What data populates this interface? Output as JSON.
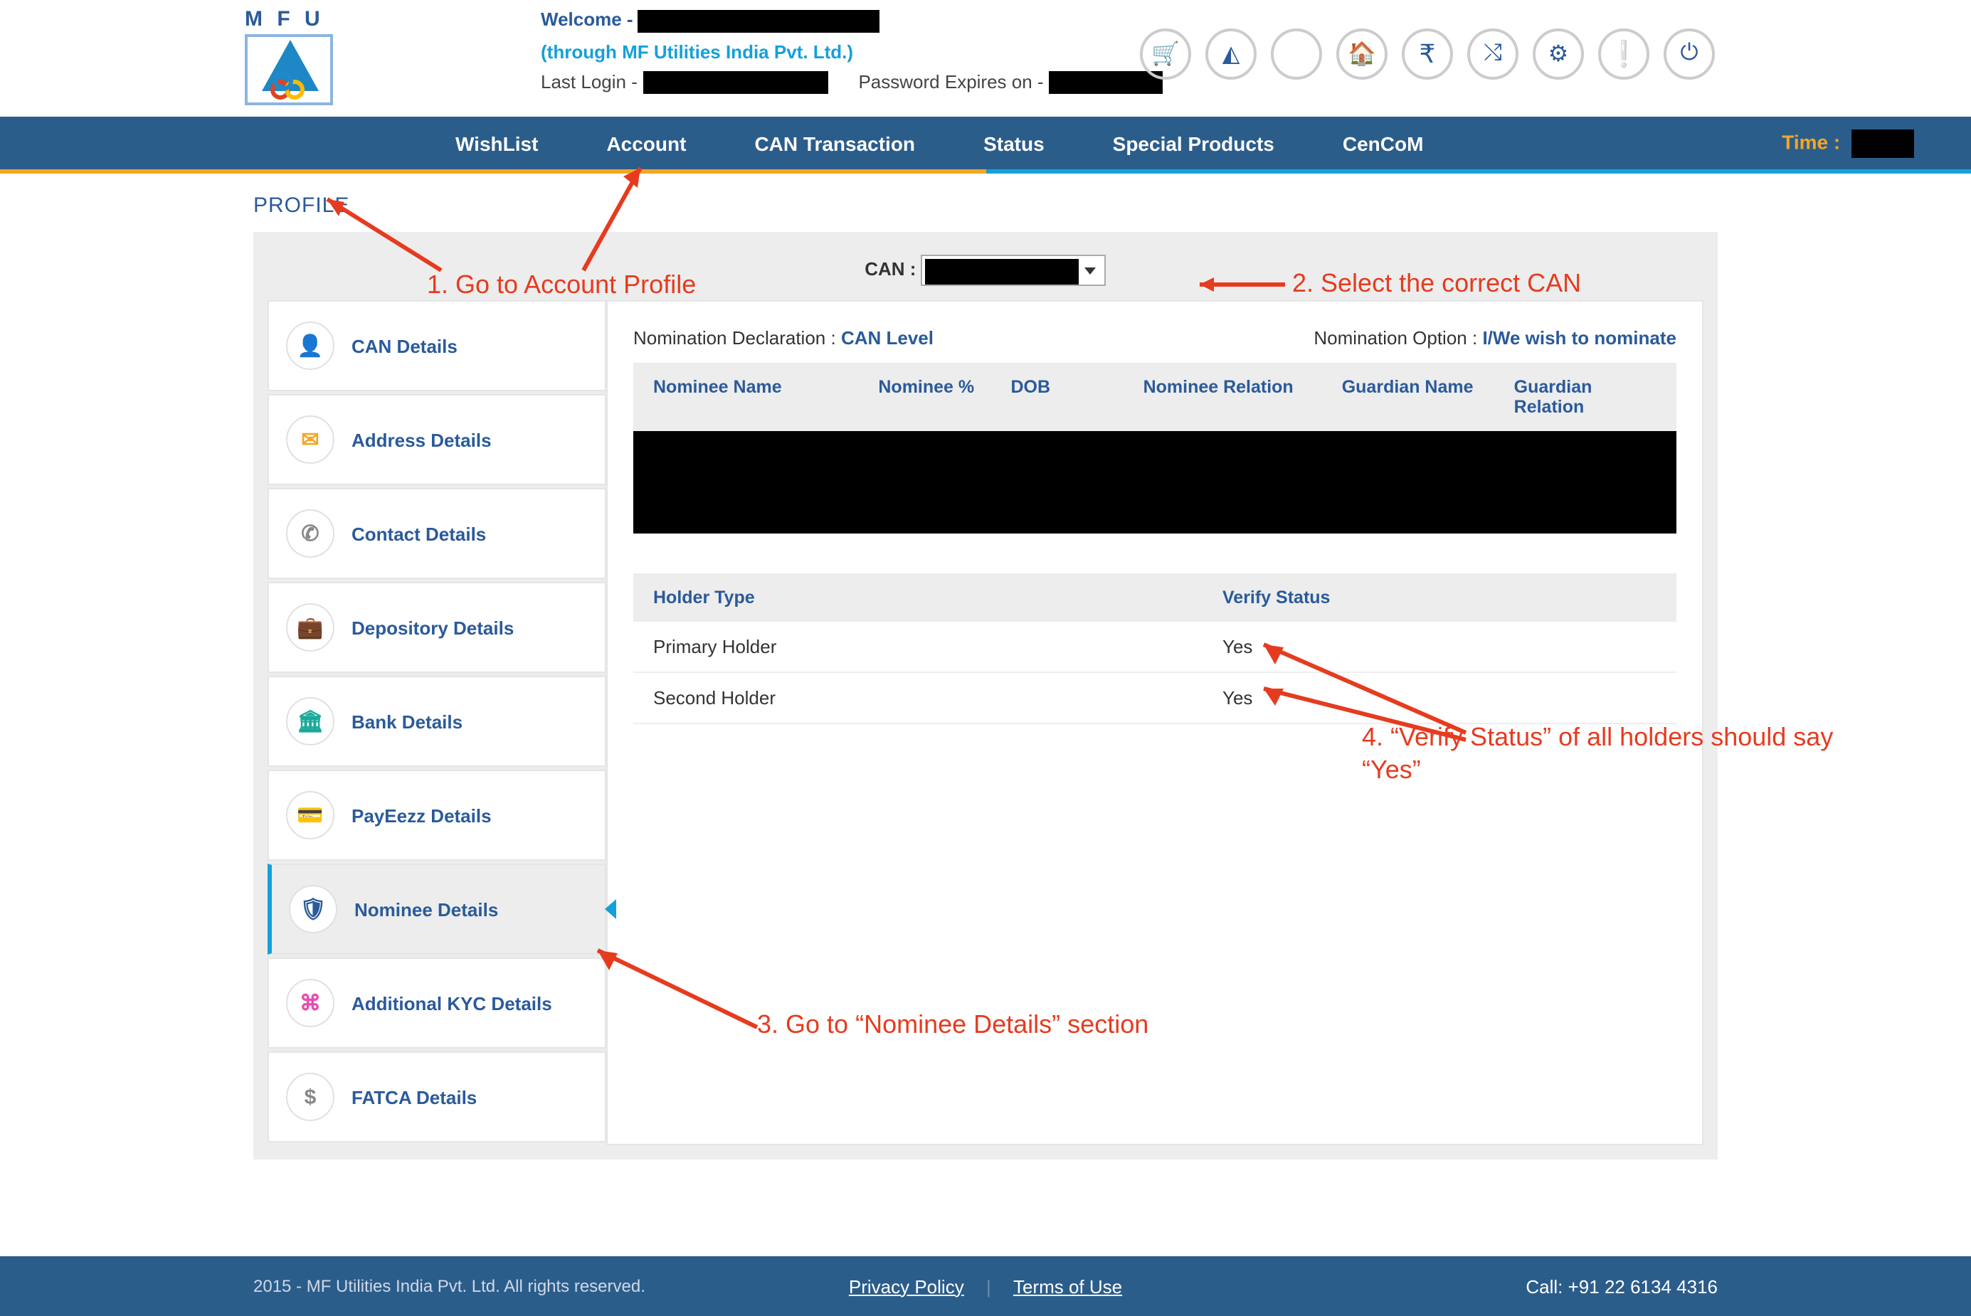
{
  "brand": {
    "name": "M F U"
  },
  "welcome": {
    "label": "Welcome - ",
    "through": "(through MF Utilities India Pvt. Ltd.)",
    "last_login_label": "Last Login -",
    "pw_expires_label": "Password Expires on -"
  },
  "top_icons": [
    "cart",
    "nav-triangle",
    "blank",
    "home",
    "rupee",
    "shuffle",
    "gear",
    "alert",
    "power"
  ],
  "nav": {
    "items": [
      "WishList",
      "Account",
      "CAN Transaction",
      "Status",
      "Special Products",
      "CenCoM"
    ],
    "time_label": "Time :"
  },
  "page_title": "PROFILE",
  "can_selector": {
    "label": "CAN :"
  },
  "sidebar": {
    "items": [
      {
        "icon": "user",
        "color": "c-blue",
        "label": "CAN Details"
      },
      {
        "icon": "mail",
        "color": "c-orange",
        "label": "Address Details"
      },
      {
        "icon": "phone",
        "color": "c-gray",
        "label": "Contact Details"
      },
      {
        "icon": "briefcase",
        "color": "c-orange",
        "label": "Depository Details"
      },
      {
        "icon": "bank",
        "color": "c-teal",
        "label": "Bank Details"
      },
      {
        "icon": "card",
        "color": "c-blue",
        "label": "PayEezz Details"
      },
      {
        "icon": "shield",
        "color": "c-navy",
        "label": "Nominee Details",
        "active": true
      },
      {
        "icon": "share",
        "color": "c-pink",
        "label": "Additional KYC Details"
      },
      {
        "icon": "dollar",
        "color": "c-gray",
        "label": "FATCA Details"
      }
    ]
  },
  "nomination": {
    "decl_label": "Nomination Declaration : ",
    "decl_value": "CAN Level",
    "opt_label": "Nomination Option : ",
    "opt_value": "I/We wish to nominate",
    "cols": [
      "Nominee Name",
      "Nominee %",
      "DOB",
      "Nominee Relation",
      "Guardian Name",
      "Guardian Relation"
    ],
    "verify_cols": [
      "Holder Type",
      "Verify Status"
    ],
    "verify_rows": [
      {
        "holder": "Primary Holder",
        "status": "Yes"
      },
      {
        "holder": "Second Holder",
        "status": "Yes"
      }
    ]
  },
  "footer": {
    "left": "2015 - MF Utilities India Pvt. Ltd. All rights reserved.",
    "links": [
      "Privacy Policy",
      "Terms of Use"
    ],
    "right": "Call: +91 22 6134 4316"
  },
  "annotations": {
    "a1": "1. Go to Account Profile",
    "a2": "2. Select the correct CAN",
    "a3": "3. Go to “Nominee Details” section",
    "a4": "4. “Verify Status” of all holders should say “Yes”"
  }
}
